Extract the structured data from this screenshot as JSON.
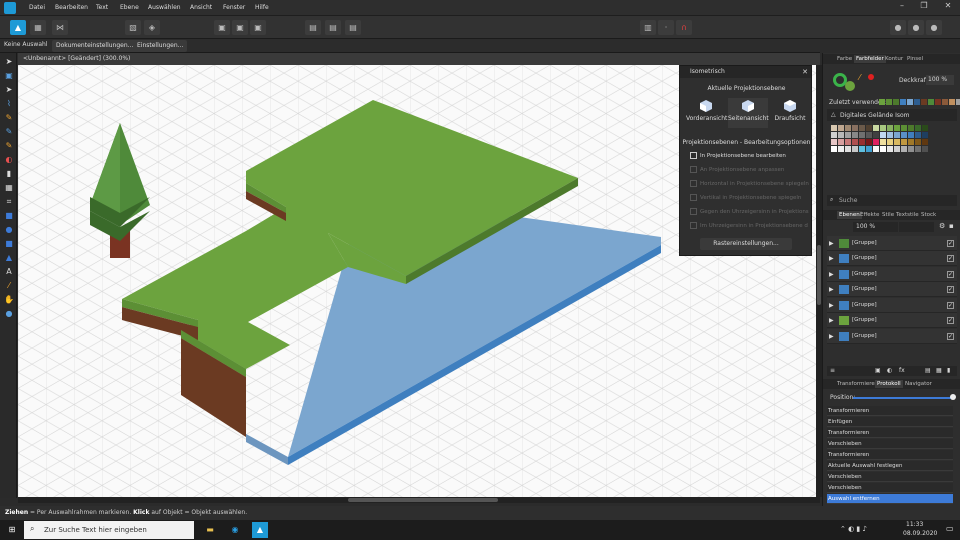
{
  "menu": [
    "Datei",
    "Bearbeiten",
    "Text",
    "Ebene",
    "Auswählen",
    "Ansicht",
    "Fenster",
    "Hilfe"
  ],
  "context_bar": {
    "no_selection": "Keine Auswahl",
    "doc_settings": "Dokumenteinstellungen...",
    "settings": "Einstellungen..."
  },
  "document_tab": "<Unbenannt> [Geändert] (300.0%)",
  "iso_panel": {
    "title": "Isometrisch",
    "current_plane": "Aktuelle Projektionsebene",
    "views": [
      "Vorderansicht",
      "Seitenansicht",
      "Draufsicht"
    ],
    "section2": "Projektionsebenen - Bearbeitungsoptionen",
    "options": [
      "In Projektionsebene bearbeiten",
      "An Projektionsebene anpassen",
      "Horizontal in Projektionsebene spiegeln",
      "Vertikal in Projektionsebene spiegeln",
      "Gegen den Uhrzeigersinn in Projektions",
      "Im Uhrzeigersinn in Projektionsebene d"
    ],
    "grid_button": "Rastereinstellungen..."
  },
  "right_panel": {
    "tabs1": [
      "Farbe",
      "Farbfelder",
      "Kontur",
      "Pinsel"
    ],
    "opacity_label": "Deckkraft:",
    "opacity_value": "100 %",
    "recent_label": "Zuletzt verwendet:",
    "palette_name": "Digitales Gelände Isom",
    "search_placeholder": "Suche",
    "tabs2": [
      "Ebenen",
      "Effekte",
      "Stile",
      "Textstile",
      "Stock"
    ],
    "layer_opacity": "100 %",
    "layers": [
      "[Gruppe]",
      "[Gruppe]",
      "[Gruppe]",
      "[Gruppe]",
      "[Gruppe]",
      "[Gruppe]",
      "[Gruppe]"
    ],
    "tabs3": [
      "Transformieren",
      "Protokoll",
      "Navigator"
    ],
    "position_label": "Position:",
    "history": [
      "Transformieren",
      "Einfügen",
      "Transformieren",
      "Verschieben",
      "Transformieren",
      "Aktuelle Auswahl festlegen",
      "Verschieben",
      "Verschieben",
      "Auswahl entfernen"
    ]
  },
  "status": {
    "drag_word": "Ziehen",
    "drag_text": " = Per Auswahlrahmen markieren. ",
    "click_word": "Klick",
    "click_text": " auf Objekt = Objekt auswählen."
  },
  "taskbar": {
    "search_placeholder": "Zur Suche Text hier eingeben",
    "time": "11:33",
    "date": "08.09.2020"
  },
  "colors": {
    "grass_top": "#6ca33e",
    "grass_left": "#5c8f35",
    "grass_right": "#4d7a2c",
    "water_top": "#7ba6cf",
    "water_right": "#3f7fbf",
    "dirt": "#6b3a22",
    "tree": "#4f8a3a",
    "accent": "#3d7bd8"
  }
}
